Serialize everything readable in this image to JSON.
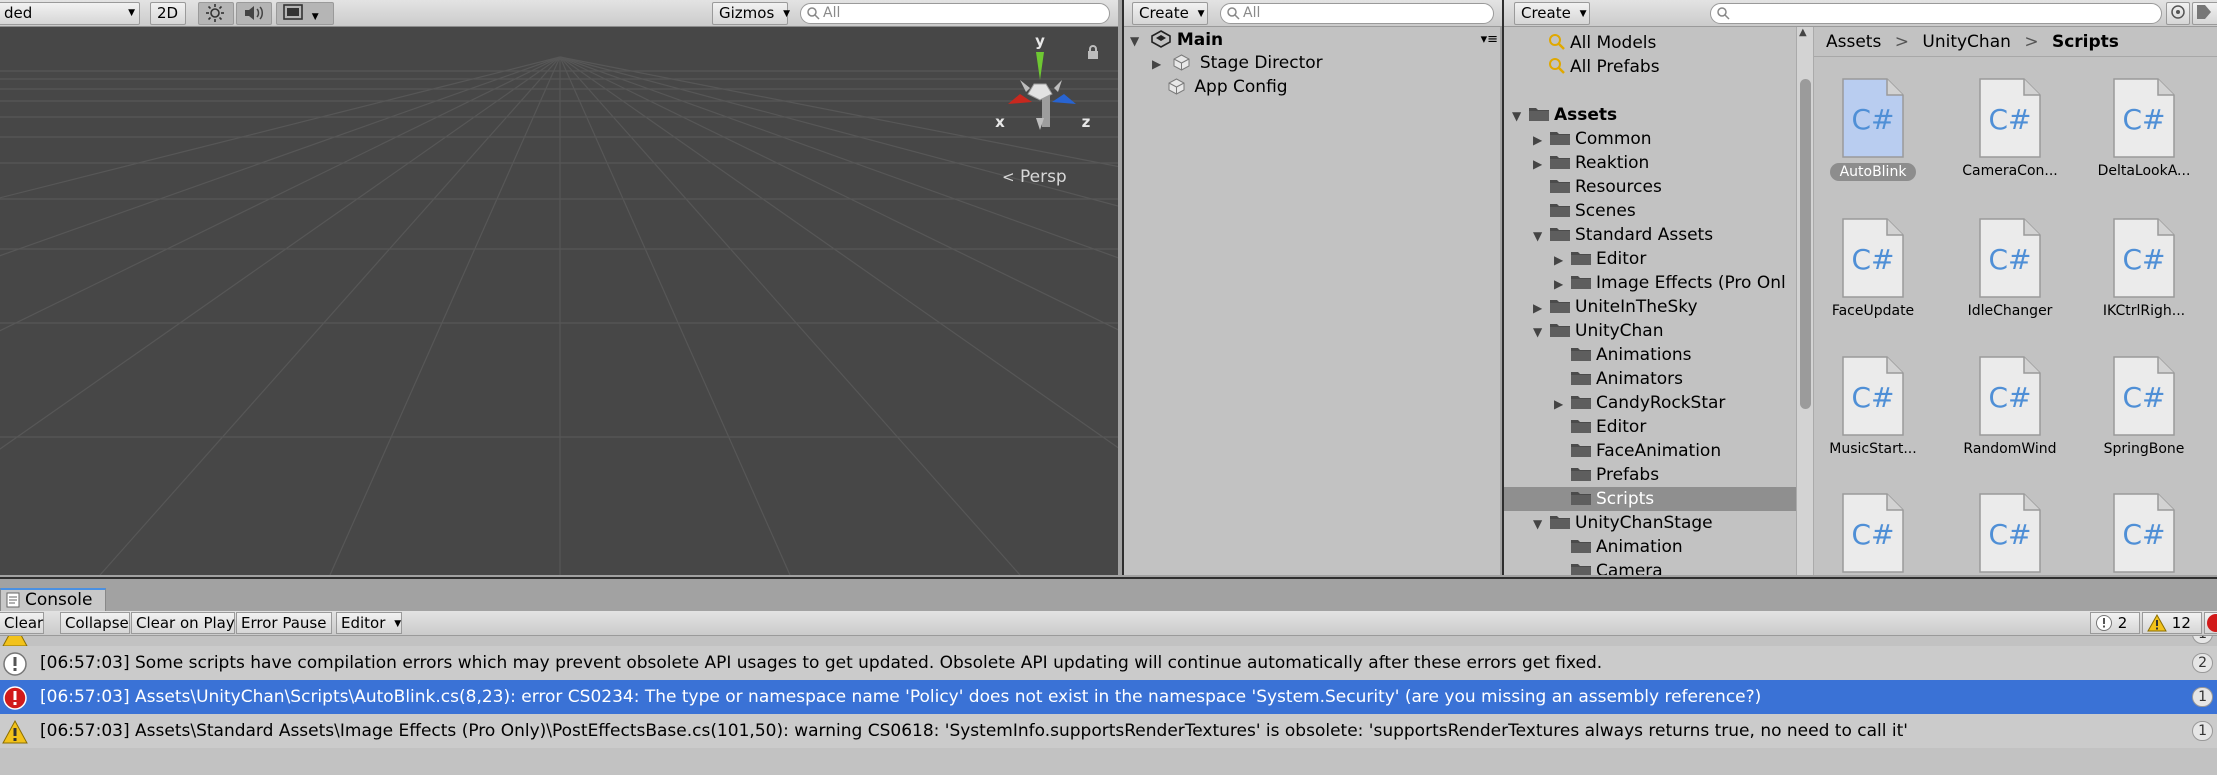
{
  "scene": {
    "shading_mode": "ded",
    "mode_2d": "2D",
    "gizmos": "Gizmos",
    "search_placeholder": "All",
    "axis_y": "y",
    "axis_x": "x",
    "axis_z": "z",
    "projection": "Persp"
  },
  "hierarchy": {
    "create_label": "Create",
    "search_placeholder": "All",
    "scene_name": "Main",
    "items": [
      {
        "label": "Stage Director",
        "has_children": true
      },
      {
        "label": "App Config",
        "has_children": false
      }
    ]
  },
  "project": {
    "create_label": "Create",
    "favorites": [
      {
        "label": "All Models"
      },
      {
        "label": "All Prefabs"
      }
    ],
    "tree": [
      {
        "label": "Assets",
        "depth": 0,
        "state": "expanded"
      },
      {
        "label": "Common",
        "depth": 1,
        "state": "collapsed"
      },
      {
        "label": "Reaktion",
        "depth": 1,
        "state": "collapsed"
      },
      {
        "label": "Resources",
        "depth": 1,
        "state": "leaf"
      },
      {
        "label": "Scenes",
        "depth": 1,
        "state": "leaf"
      },
      {
        "label": "Standard Assets",
        "depth": 1,
        "state": "expanded"
      },
      {
        "label": "Editor",
        "depth": 2,
        "state": "collapsed"
      },
      {
        "label": "Image Effects (Pro Onl",
        "depth": 2,
        "state": "collapsed"
      },
      {
        "label": "UniteInTheSky",
        "depth": 1,
        "state": "collapsed"
      },
      {
        "label": "UnityChan",
        "depth": 1,
        "state": "expanded"
      },
      {
        "label": "Animations",
        "depth": 2,
        "state": "leaf"
      },
      {
        "label": "Animators",
        "depth": 2,
        "state": "leaf"
      },
      {
        "label": "CandyRockStar",
        "depth": 2,
        "state": "collapsed"
      },
      {
        "label": "Editor",
        "depth": 2,
        "state": "leaf"
      },
      {
        "label": "FaceAnimation",
        "depth": 2,
        "state": "leaf"
      },
      {
        "label": "Prefabs",
        "depth": 2,
        "state": "leaf"
      },
      {
        "label": "Scripts",
        "depth": 2,
        "state": "leaf",
        "selected": true
      },
      {
        "label": "UnityChanStage",
        "depth": 1,
        "state": "expanded"
      },
      {
        "label": "Animation",
        "depth": 2,
        "state": "leaf"
      },
      {
        "label": "Camera",
        "depth": 2,
        "state": "leaf"
      }
    ],
    "breadcrumb": [
      "Assets",
      "UnityChan",
      "Scripts"
    ],
    "script_glyph": "C#",
    "assets": [
      {
        "label": "AutoBlink",
        "selected": true
      },
      {
        "label": "CameraCon..."
      },
      {
        "label": "DeltaLookA..."
      },
      {
        "label": "FaceUpdate"
      },
      {
        "label": "IdleChanger"
      },
      {
        "label": "IKCtrlRigh..."
      },
      {
        "label": "MusicStart..."
      },
      {
        "label": "RandomWind"
      },
      {
        "label": "SpringBone"
      },
      {
        "label": ""
      },
      {
        "label": ""
      },
      {
        "label": ""
      }
    ]
  },
  "console": {
    "tab_label": "Console",
    "buttons": {
      "clear": "Clear",
      "collapse": "Collapse",
      "clear_on_play": "Clear on Play",
      "error_pause": "Error Pause",
      "editor": "Editor"
    },
    "counts": {
      "info": "2",
      "warnings": "12"
    },
    "logs": [
      {
        "type": "info",
        "text": "[06:57:03] Some scripts have compilation errors which may prevent obsolete API usages to get updated. Obsolete API updating will continue automatically after these errors get fixed.",
        "count": "2"
      },
      {
        "type": "error",
        "text": "[06:57:03] Assets\\UnityChan\\Scripts\\AutoBlink.cs(8,23): error CS0234: The type or namespace name 'Policy' does not exist in the namespace 'System.Security' (are you missing an assembly reference?)",
        "count": "1",
        "selected": true
      },
      {
        "type": "warning",
        "text": "[06:57:03] Assets\\Standard Assets\\Image Effects (Pro Only)\\PostEffectsBase.cs(101,50): warning CS0618: 'SystemInfo.supportsRenderTextures' is obsolete: 'supportsRenderTextures always returns true, no need to call it'",
        "count": "1"
      }
    ]
  },
  "colors": {
    "scene_bg": "#474747",
    "panel_bg": "#c2c2c2",
    "selection": "#3a72d6",
    "error": "#d11a1a",
    "warning": "#f2c21b",
    "gizmo_y": "#6ec832",
    "gizmo_x": "#c8281e",
    "gizmo_z": "#2864d2"
  }
}
